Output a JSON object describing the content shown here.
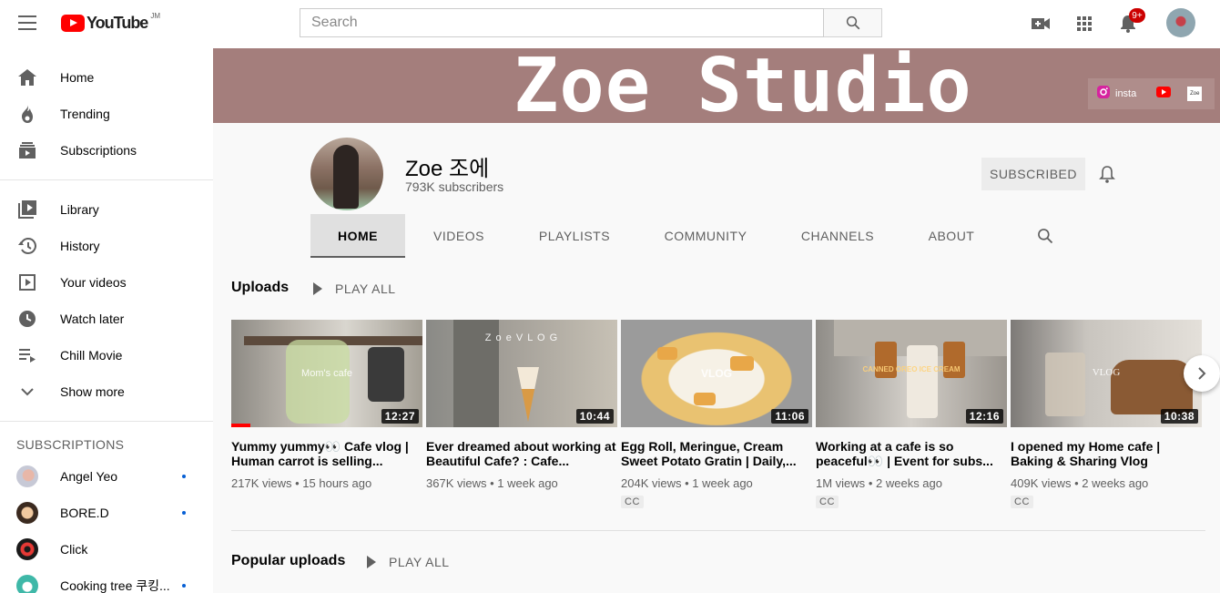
{
  "header": {
    "logo_text": "YouTube",
    "logo_region": "JM",
    "search_placeholder": "Search",
    "notification_badge": "9+"
  },
  "sidebar": {
    "main_items": [
      {
        "label": "Home",
        "icon": "home-icon"
      },
      {
        "label": "Trending",
        "icon": "trending-icon"
      },
      {
        "label": "Subscriptions",
        "icon": "subscriptions-icon"
      }
    ],
    "library_items": [
      {
        "label": "Library",
        "icon": "library-icon"
      },
      {
        "label": "History",
        "icon": "history-icon"
      },
      {
        "label": "Your videos",
        "icon": "your-videos-icon"
      },
      {
        "label": "Watch later",
        "icon": "watch-later-icon"
      },
      {
        "label": "Chill Movie",
        "icon": "playlist-icon"
      },
      {
        "label": "Show more",
        "icon": "chevron-down-icon"
      }
    ],
    "subscriptions_title": "SUBSCRIPTIONS",
    "subscriptions": [
      {
        "name": "Angel Yeo",
        "has_new": true
      },
      {
        "name": "BORE.D",
        "has_new": true
      },
      {
        "name": "Click",
        "has_new": false
      },
      {
        "name": "Cooking tree 쿠킹...",
        "has_new": true
      }
    ]
  },
  "banner": {
    "title": "Zoe Studio",
    "link_insta": "insta",
    "link_zoe": "Zoe",
    "bg_color": "#a47e7c"
  },
  "channel": {
    "name": "Zoe 조에",
    "subscribers": "793K subscribers",
    "subscribe_label": "SUBSCRIBED",
    "tabs": [
      "HOME",
      "VIDEOS",
      "PLAYLISTS",
      "COMMUNITY",
      "CHANNELS",
      "ABOUT"
    ],
    "active_tab": "HOME"
  },
  "uploads": {
    "title": "Uploads",
    "play_all": "PLAY ALL",
    "videos": [
      {
        "title": "Yummy yummy👀 Cafe vlog | Human carrot is selling...",
        "views": "217K views",
        "age": "15 hours ago",
        "duration": "12:27",
        "cc": false,
        "watched_fraction": 0.1,
        "overlay": "Mom's cafe"
      },
      {
        "title": "Ever dreamed about working at Beautiful Cafe? : Cafe...",
        "views": "367K views",
        "age": "1 week ago",
        "duration": "10:44",
        "cc": false,
        "overlay": "Z o e   V L O G"
      },
      {
        "title": "Egg Roll, Meringue, Cream Sweet Potato Gratin | Daily,...",
        "views": "204K views",
        "age": "1 week ago",
        "duration": "11:06",
        "cc": true,
        "overlay": "VLOG"
      },
      {
        "title": "Working at a cafe is so peaceful👀 | Event for subs...",
        "views": "1M views",
        "age": "2 weeks ago",
        "duration": "12:16",
        "cc": true,
        "overlay": "CANNED OREO ICE CREAM"
      },
      {
        "title": "I opened my Home cafe | Baking & Sharing Vlog",
        "views": "409K views",
        "age": "2 weeks ago",
        "duration": "10:38",
        "cc": true,
        "overlay": "VLOG"
      }
    ],
    "cc_label": "CC",
    "meta_sep": "•"
  },
  "popular": {
    "title": "Popular uploads",
    "play_all": "PLAY ALL"
  }
}
